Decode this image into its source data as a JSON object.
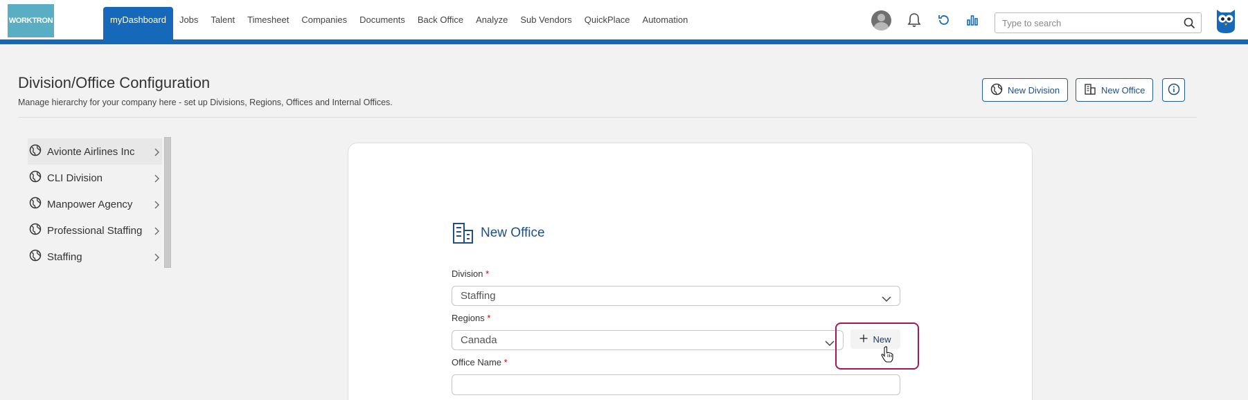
{
  "app": {
    "logo_text": "WORKTRON"
  },
  "nav": {
    "items": [
      {
        "label": "myDashboard",
        "active": true
      },
      {
        "label": "Jobs"
      },
      {
        "label": "Talent"
      },
      {
        "label": "Timesheet"
      },
      {
        "label": "Companies"
      },
      {
        "label": "Documents"
      },
      {
        "label": "Back Office"
      },
      {
        "label": "Analyze"
      },
      {
        "label": "Sub Vendors"
      },
      {
        "label": "QuickPlace"
      },
      {
        "label": "Automation"
      }
    ]
  },
  "topbar": {
    "icons": [
      "avatar",
      "bell-icon",
      "refresh-icon",
      "bar-chart-icon",
      "owl-logo-icon"
    ],
    "search_placeholder": "Type to search"
  },
  "header": {
    "title": "Division/Office Configuration",
    "subtitle": "Manage hierarchy for your company here - set up Divisions, Regions, Offices and Internal Offices.",
    "new_division_label": "New Division",
    "new_office_label": "New Office"
  },
  "sidebar": {
    "items": [
      {
        "label": "Avionte Airlines Inc",
        "active": true
      },
      {
        "label": "CLI Division"
      },
      {
        "label": "Manpower Agency"
      },
      {
        "label": "Professional Staffing"
      },
      {
        "label": "Staffing"
      }
    ]
  },
  "form": {
    "title": "New Office",
    "division_label": "Division",
    "division_value": "Staffing",
    "regions_label": "Regions",
    "regions_value": "Canada",
    "new_region_label": "New",
    "office_name_label": "Office Name",
    "office_name_value": "",
    "required_mark": "*"
  },
  "colors": {
    "primary": "#1569b8",
    "accent_text": "#1f4f86",
    "highlight": "#a3165a",
    "logo_bg": "#5aaec3"
  }
}
